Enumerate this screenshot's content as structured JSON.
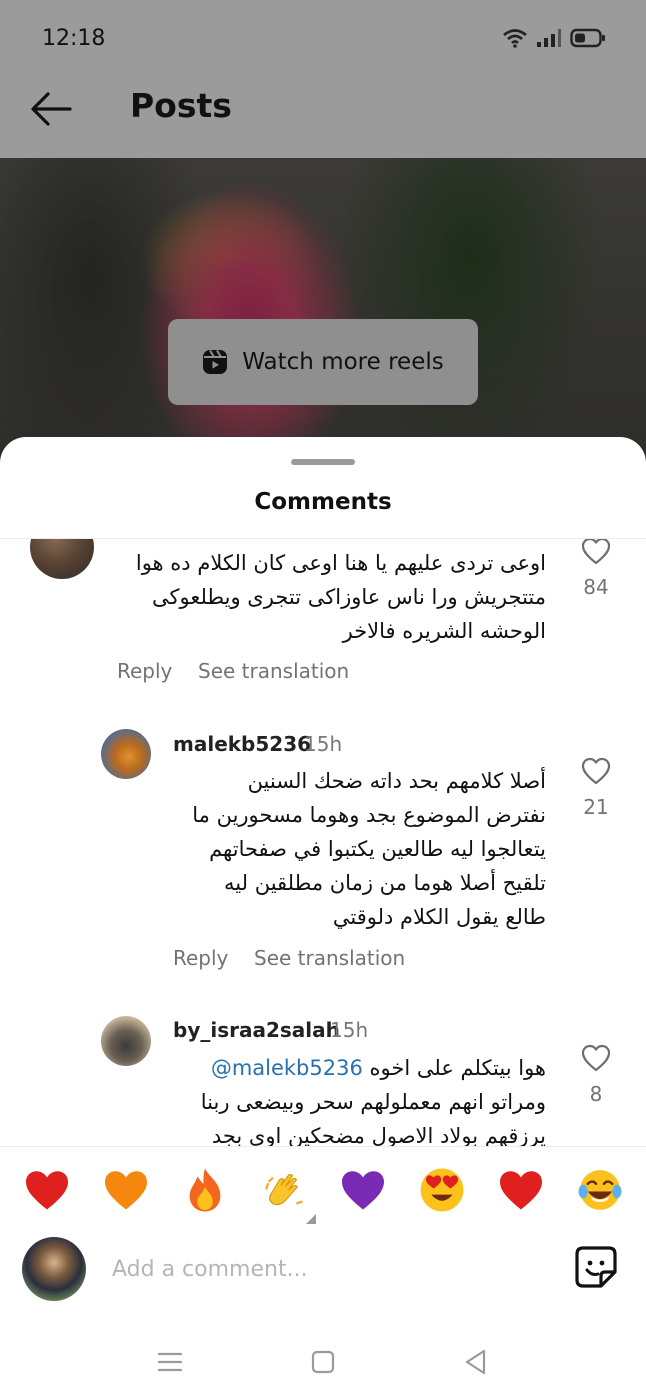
{
  "status_bar": {
    "time": "12:18"
  },
  "header": {
    "title": "Posts"
  },
  "post": {
    "reels_button_label": "Watch more reels"
  },
  "comments_sheet": {
    "title": "Comments",
    "comments": [
      {
        "username": "",
        "time": "",
        "text": "اوعى تردى عليهم يا هنا اوعى  كان الكلام ده هوا\nمتتجريش ورا ناس عاوزاكى تتجرى ويطلعوكى\nالوحشه الشريره فالاخر",
        "mention": "",
        "likes": "84",
        "reply_label": "Reply",
        "translate_label": "See translation"
      },
      {
        "username": "malekb5236",
        "time": "15h",
        "text": "أصلا كلامهم بحد داته ضحك السنين\nنفترض الموضوع بجد وهوما مسحورين ما\nيتعالجوا ليه طالعين يكتبوا في صفحاتهم\nتلقيح أصلا هوما من زمان مطلقين ليه\nطالع يقول الكلام دلوقتي",
        "mention": "",
        "likes": "21",
        "reply_label": "Reply",
        "translate_label": "See translation"
      },
      {
        "username": "by_israa2salah",
        "time": "15h",
        "text": "هوا بيتكلم على اخوه\nومراتو انهم معملولهم سحر وبيضعى ربنا\nيرزقهم بولاد الاصول مضحكين اوى بجد",
        "mention": "@malekb5236",
        "likes": "8",
        "reply_label": "",
        "translate_label": ""
      }
    ]
  },
  "emoji_bar": {
    "emojis": [
      "red-heart",
      "orange-heart",
      "fire",
      "clapping-hands",
      "purple-heart",
      "heart-eyes",
      "red-heart",
      "tears-of-joy"
    ]
  },
  "composer": {
    "placeholder": "Add a comment..."
  },
  "colors": {
    "mention": "#2a6fb0",
    "secondary_text": "#737373",
    "sheet_bg": "#ffffff"
  }
}
